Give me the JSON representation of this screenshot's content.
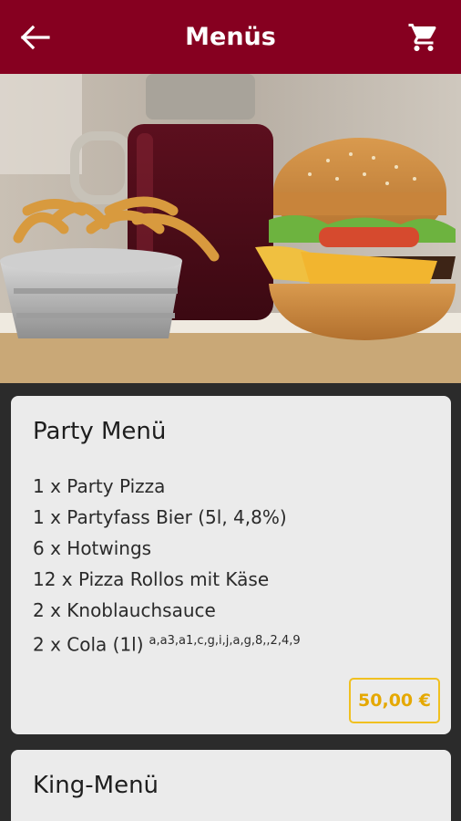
{
  "header": {
    "title": "Menüs",
    "back_icon": "arrow-left-icon",
    "cart_icon": "shopping-cart-icon",
    "color": "#860020"
  },
  "hero": {
    "image": "burger-fries-drink-photo"
  },
  "menus": [
    {
      "name": "Party Menü",
      "items": [
        {
          "text": "1 x Party Pizza",
          "allergens": ""
        },
        {
          "text": "1 x Partyfass Bier (5l, 4,8%)",
          "allergens": ""
        },
        {
          "text": "6 x Hotwings",
          "allergens": ""
        },
        {
          "text": "12 x Pizza Rollos mit Käse",
          "allergens": ""
        },
        {
          "text": "2 x Knoblauchsauce",
          "allergens": ""
        },
        {
          "text": "2 x Cola (1l)",
          "allergens": "a,a3,a1,c,g,i,j,a,g,8,,2,4,9"
        }
      ],
      "price": "50,00 €"
    },
    {
      "name": "King-Menü"
    }
  ],
  "colors": {
    "accent": "#860020",
    "price_border": "#f0c020",
    "price_text": "#e5a800",
    "card_bg": "#ebebeb",
    "page_bg": "#2b2b2b"
  }
}
